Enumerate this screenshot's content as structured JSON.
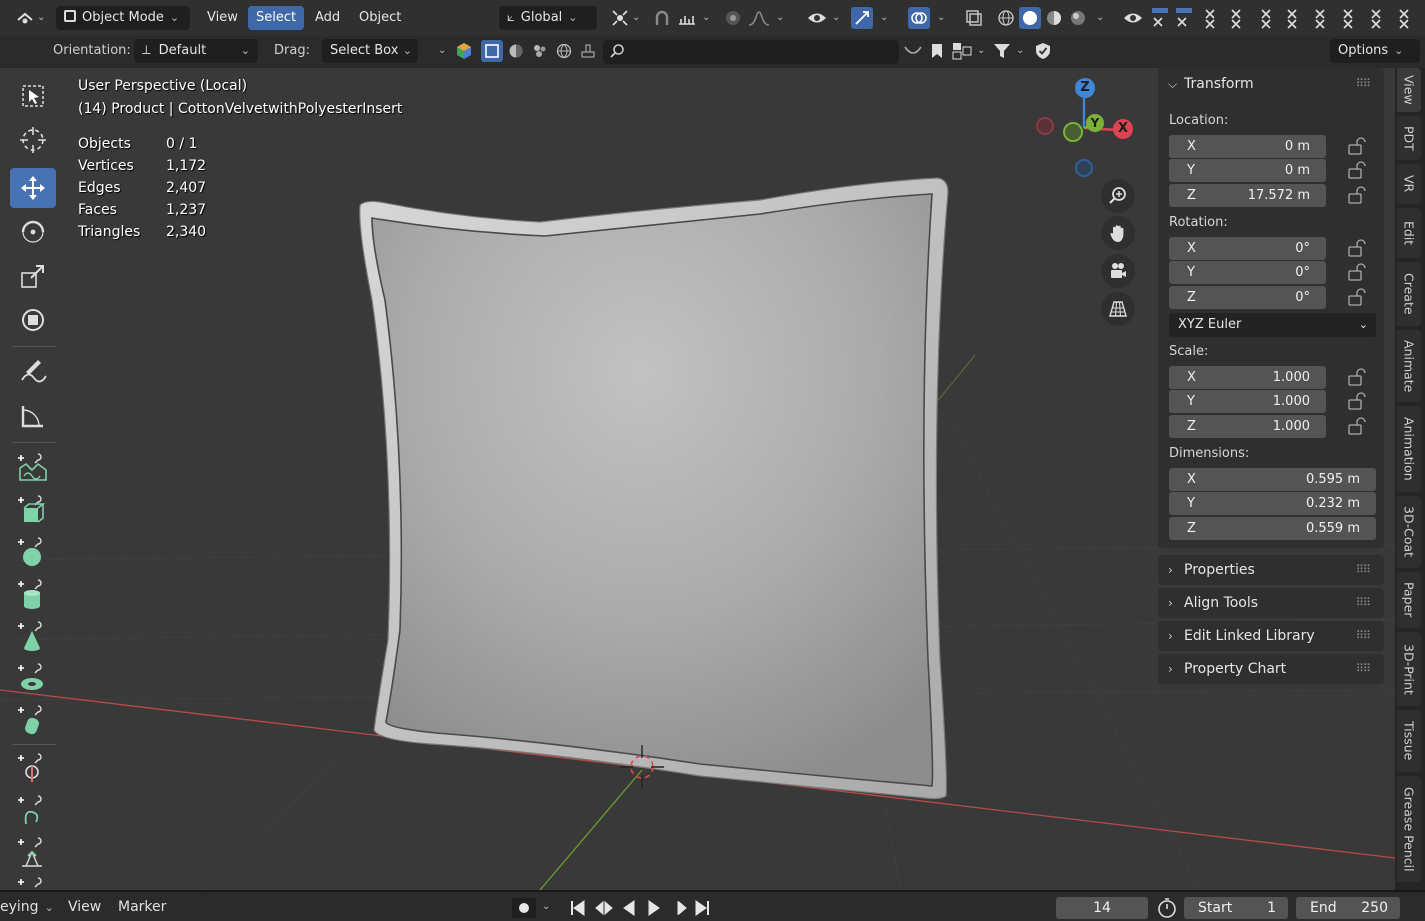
{
  "header": {
    "mode": "Object Mode",
    "menus": [
      "View",
      "Select",
      "Add",
      "Object"
    ],
    "active_menu": "Select",
    "transform_orientation": "Global",
    "options_label": "Options"
  },
  "tool_settings": {
    "orientation_label": "Orientation:",
    "orientation_value": "Default",
    "drag_label": "Drag:",
    "drag_value": "Select Box"
  },
  "viewport": {
    "view_name": "User Perspective (Local)",
    "active_object": "(14) Product | CottonVelvetwithPolyesterInsert",
    "stats": [
      {
        "label": "Objects",
        "value": "0 / 1"
      },
      {
        "label": "Vertices",
        "value": "1,172"
      },
      {
        "label": "Edges",
        "value": "2,407"
      },
      {
        "label": "Faces",
        "value": "1,237"
      },
      {
        "label": "Triangles",
        "value": "2,340"
      }
    ],
    "gizmo": {
      "x": "X",
      "y": "Y",
      "z": "Z"
    }
  },
  "npanel": {
    "transform_title": "Transform",
    "location_label": "Location:",
    "location": [
      {
        "axis": "X",
        "value": "0 m"
      },
      {
        "axis": "Y",
        "value": "0 m"
      },
      {
        "axis": "Z",
        "value": "17.572 m"
      }
    ],
    "rotation_label": "Rotation:",
    "rotation": [
      {
        "axis": "X",
        "value": "0°"
      },
      {
        "axis": "Y",
        "value": "0°"
      },
      {
        "axis": "Z",
        "value": "0°"
      }
    ],
    "rotation_mode": "XYZ Euler",
    "scale_label": "Scale:",
    "scale": [
      {
        "axis": "X",
        "value": "1.000"
      },
      {
        "axis": "Y",
        "value": "1.000"
      },
      {
        "axis": "Z",
        "value": "1.000"
      }
    ],
    "dimensions_label": "Dimensions:",
    "dimensions": [
      {
        "axis": "X",
        "value": "0.595 m"
      },
      {
        "axis": "Y",
        "value": "0.232 m"
      },
      {
        "axis": "Z",
        "value": "0.559 m"
      }
    ],
    "collapsed_panels": [
      "Properties",
      "Align Tools",
      "Edit Linked Library",
      "Property Chart"
    ]
  },
  "side_tabs": [
    "View",
    "PDT",
    "VR",
    "Edit",
    "Create",
    "Animate",
    "Animation",
    "3D-Coat",
    "Paper",
    "3D-Print",
    "Tissue",
    "Grease Pencil"
  ],
  "timeline": {
    "playback_label": "eying",
    "view_menu": "View",
    "marker_menu": "Marker",
    "current_frame": "14",
    "start_label": "Start",
    "start_value": "1",
    "end_label": "End",
    "end_value": "250"
  },
  "colors": {
    "accent": "#4772b3",
    "axis_x": "#e0424f",
    "axis_y": "#7bb33a",
    "axis_z": "#3f86d6"
  }
}
